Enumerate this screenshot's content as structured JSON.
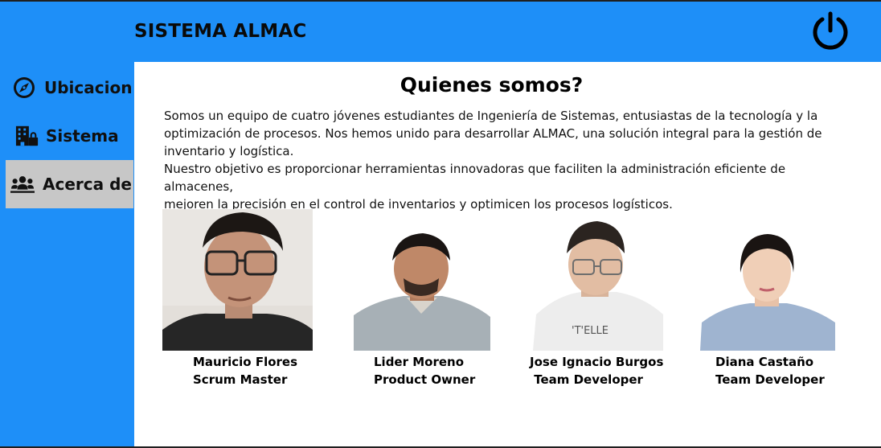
{
  "app": {
    "title": "SISTEMA ALMAC"
  },
  "header": {
    "power_icon": "power-icon"
  },
  "sidebar": {
    "items": [
      {
        "label": "Ubicacion",
        "icon": "compass-icon",
        "active": false
      },
      {
        "label": "Sistema",
        "icon": "building-lock-icon",
        "active": false
      },
      {
        "label": "Acerca de",
        "icon": "users-icon",
        "active": true
      }
    ]
  },
  "about": {
    "heading": "Quienes somos?",
    "lines": [
      "Somos un equipo de cuatro jóvenes estudiantes de Ingeniería de Sistemas, entusiastas de la tecnología y la",
      "optimización de procesos. Nos hemos unido para desarrollar ALMAC, una solución integral para la gestión de",
      "inventario y logística.",
      "Nuestro objetivo es proporcionar herramientas innovadoras que faciliten la administración eficiente de almacenes,",
      "mejoren la precisión en el control de inventarios y optimicen los procesos logísticos."
    ]
  },
  "team": [
    {
      "name": "Mauricio Flores",
      "role": "Scrum Master"
    },
    {
      "name": "Lider Moreno",
      "role": "Product Owner"
    },
    {
      "name": "Jose Ignacio Burgos",
      "role": " Team Developer"
    },
    {
      "name": "Diana Castaño",
      "role": "Team Developer"
    }
  ],
  "colors": {
    "accent": "#1e8ff8",
    "active_nav": "#c7c7c7",
    "content_bg": "#ffffff"
  }
}
